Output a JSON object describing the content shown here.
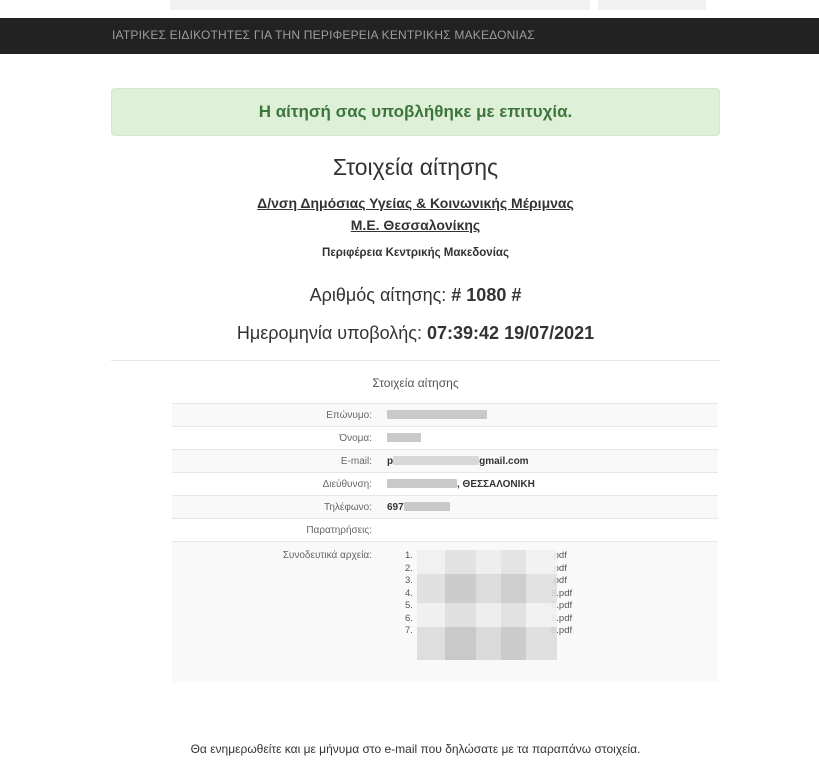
{
  "navbar": {
    "brand": "ΙΑΤΡΙΚΕΣ ΕΙΔΙΚΟΤΗΤΕΣ ΓΙΑ ΤΗΝ ΠΕΡΙΦΕΡΕΙΑ ΚΕΝΤΡΙΚΗΣ ΜΑΚΕΔΟΝΙΑΣ"
  },
  "alert": {
    "message": "Η αίτησή σας υποβλήθηκε με επιτυχία."
  },
  "header": {
    "title": "Στοιχεία αίτησης",
    "department_line1": "Δ/νση Δημόσιας Υγείας & Κοινωνικής Μέριμνας",
    "department_line2": "Μ.Ε. Θεσσαλονίκης",
    "region": "Περιφέρεια Κεντρικής Μακεδονίας",
    "number_label": "Αριθμός αίτησης:",
    "number_value": "# 1080 #",
    "date_label": "Ημερομηνία υποβολής:",
    "date_value": "07:39:42 19/07/2021"
  },
  "details": {
    "caption": "Στοιχεία αίτησης",
    "surname_label": "Επώνυμο:",
    "name_label": "Όνομα:",
    "email_label": "E-mail:",
    "email_prefix": "p",
    "email_suffix": "gmail.com",
    "address_label": "Διεύθυνση:",
    "address_suffix": ", ΘΕΣΣΑΛΟΝΙΚΗ",
    "phone_label": "Τηλέφωνο:",
    "phone_prefix": "697",
    "notes_label": "Παρατηρήσεις:",
    "files_label": "Συνοδευτικά αρχεία:",
    "files": [
      {
        "num": "1.",
        "suffix": ".pdf"
      },
      {
        "num": "2.",
        "suffix": ".pdf"
      },
      {
        "num": "3.",
        "suffix": ".pdf"
      },
      {
        "num": "4.",
        "suffix": "6.pdf"
      },
      {
        "num": "5.",
        "suffix": "6.pdf"
      },
      {
        "num": "6.",
        "suffix": "6.pdf"
      },
      {
        "num": "7.",
        "suffix": "6.pdf"
      }
    ]
  },
  "footer": {
    "note": "Θα ενημερωθείτε και με μήνυμα στο e-mail που δηλώσατε με τα παραπάνω στοιχεία."
  }
}
